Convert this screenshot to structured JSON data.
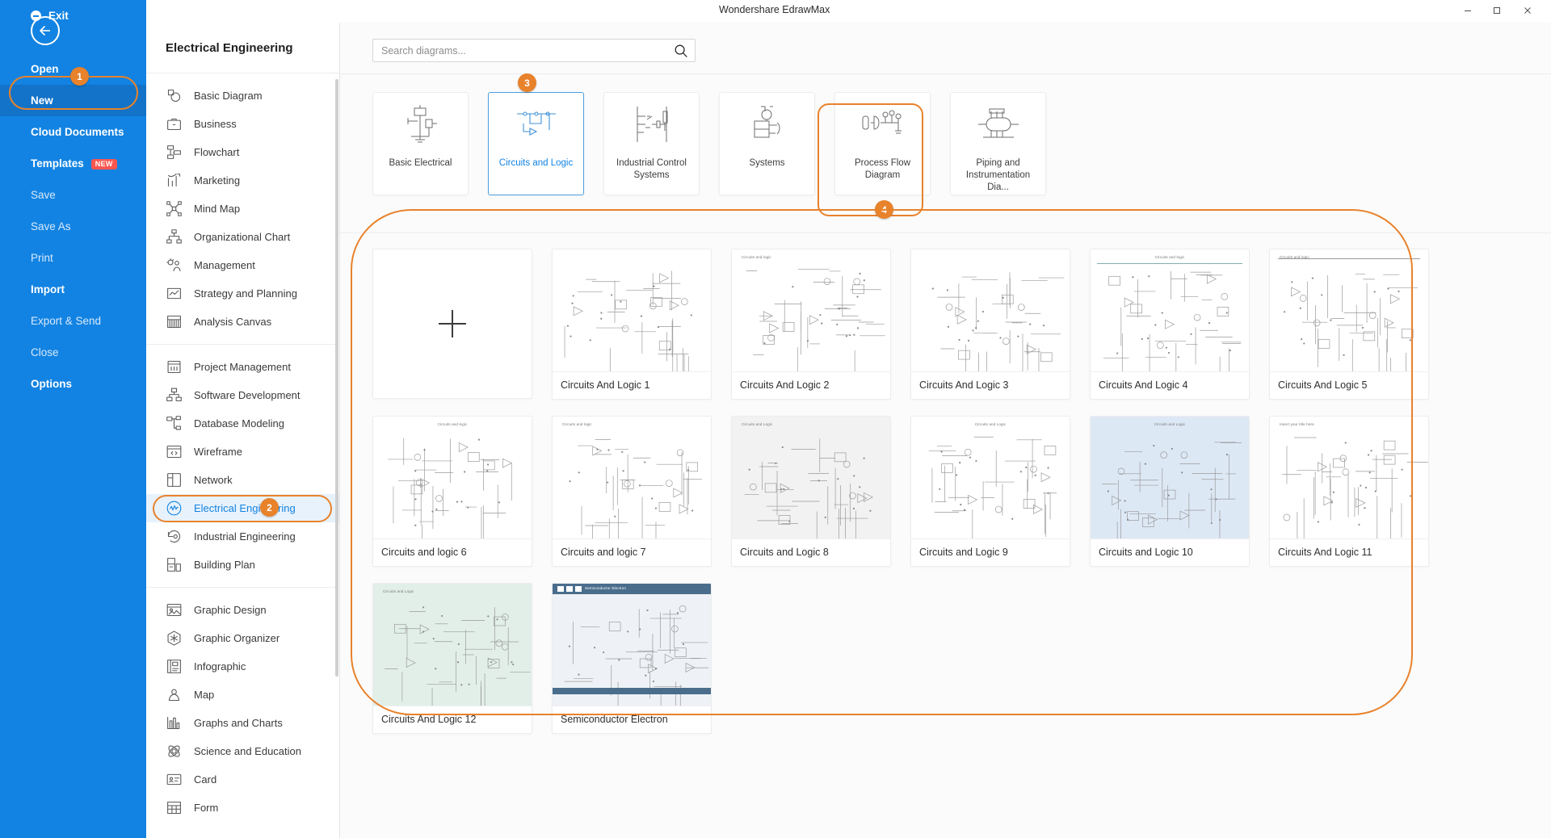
{
  "window": {
    "title": "Wondershare EdrawMax",
    "controls": {
      "minimize": "minimize-icon",
      "maximize": "maximize-icon",
      "close": "close-icon"
    }
  },
  "accent": {
    "orange": "#E8822B",
    "blue": "#1283e2",
    "selected_bg": "#e8f2fc"
  },
  "left_menu": {
    "back_icon": "back-arrow-icon",
    "items": [
      {
        "label": "Open",
        "state": "normal"
      },
      {
        "label": "New",
        "state": "active"
      },
      {
        "label": "Cloud Documents",
        "state": "normal"
      },
      {
        "label": "Templates",
        "state": "normal",
        "badge": "NEW"
      },
      {
        "label": "Save",
        "state": "dim"
      },
      {
        "label": "Save As",
        "state": "dim"
      },
      {
        "label": "Print",
        "state": "dim"
      },
      {
        "label": "Import",
        "state": "normal"
      },
      {
        "label": "Export & Send",
        "state": "dim"
      },
      {
        "label": "Close",
        "state": "dim"
      },
      {
        "label": "Options",
        "state": "normal"
      }
    ],
    "exit": {
      "label": "Exit",
      "icon": "exit-icon"
    }
  },
  "category_panel": {
    "header": "Electrical Engineering",
    "groups": [
      {
        "items": [
          {
            "label": "Basic Diagram",
            "icon": "basic-diagram-icon"
          },
          {
            "label": "Business",
            "icon": "briefcase-icon"
          },
          {
            "label": "Flowchart",
            "icon": "flowchart-icon"
          },
          {
            "label": "Marketing",
            "icon": "bar-chart-icon"
          },
          {
            "label": "Mind Map",
            "icon": "mind-map-icon"
          },
          {
            "label": "Organizational Chart",
            "icon": "org-chart-icon"
          },
          {
            "label": "Management",
            "icon": "management-icon"
          },
          {
            "label": "Strategy and Planning",
            "icon": "strategy-icon"
          },
          {
            "label": "Analysis Canvas",
            "icon": "analysis-canvas-icon"
          }
        ]
      },
      {
        "items": [
          {
            "label": "Project Management",
            "icon": "project-management-icon"
          },
          {
            "label": "Software Development",
            "icon": "software-dev-icon"
          },
          {
            "label": "Database Modeling",
            "icon": "database-modeling-icon"
          },
          {
            "label": "Wireframe",
            "icon": "wireframe-icon"
          },
          {
            "label": "Network",
            "icon": "network-icon"
          },
          {
            "label": "Electrical Engineering",
            "icon": "electrical-engineering-icon",
            "selected": true
          },
          {
            "label": "Industrial Engineering",
            "icon": "industrial-engineering-icon"
          },
          {
            "label": "Building Plan",
            "icon": "building-plan-icon"
          }
        ]
      },
      {
        "items": [
          {
            "label": "Graphic Design",
            "icon": "graphic-design-icon"
          },
          {
            "label": "Graphic Organizer",
            "icon": "graphic-organizer-icon"
          },
          {
            "label": "Infographic",
            "icon": "infographic-icon"
          },
          {
            "label": "Map",
            "icon": "map-icon"
          },
          {
            "label": "Graphs and Charts",
            "icon": "graphs-charts-icon"
          },
          {
            "label": "Science and Education",
            "icon": "science-education-icon"
          },
          {
            "label": "Card",
            "icon": "card-icon"
          },
          {
            "label": "Form",
            "icon": "form-icon"
          }
        ]
      }
    ]
  },
  "search": {
    "value": "",
    "placeholder": "Search diagrams...",
    "icon": "search-icon"
  },
  "subcategories": [
    {
      "label": "Basic Electrical",
      "icon": "basic-electrical-icon",
      "active": false
    },
    {
      "label": "Circuits and Logic",
      "icon": "circuits-logic-icon",
      "active": true
    },
    {
      "label": "Industrial Control\nSystems",
      "icon": "industrial-control-icon",
      "active": false
    },
    {
      "label": "Systems",
      "icon": "systems-icon",
      "active": false
    },
    {
      "label": "Process Flow Diagram",
      "icon": "process-flow-icon",
      "active": false
    },
    {
      "label": "Piping and\nInstrumentation Dia...",
      "icon": "piping-instr-icon",
      "active": false
    }
  ],
  "templates": {
    "new_blank": {
      "label": "",
      "icon": "plus-icon"
    },
    "rows": [
      [
        {
          "name": "Circuits And Logic 1",
          "preview_title": "",
          "style": "plain"
        },
        {
          "name": "Circuits And Logic 2",
          "preview_title": "Circuits and logic",
          "style": "plain"
        },
        {
          "name": "Circuits And Logic 3",
          "preview_title": "",
          "style": "plain"
        },
        {
          "name": "Circuits And Logic 4",
          "preview_title": "Circuits and logic",
          "style": "lined"
        },
        {
          "name": "Circuits And Logic 5",
          "preview_title": "Circuits and logic",
          "style": "ruled"
        }
      ],
      [
        {
          "name": "Circuits and logic 6",
          "preview_title": "Circuits and logic",
          "style": "plain"
        },
        {
          "name": "Circuits and logic 7",
          "preview_title": "Circuits and logic",
          "style": "plain"
        },
        {
          "name": "Circuits and Logic 8",
          "preview_title": "Circuits and Logic",
          "style": "grey"
        },
        {
          "name": "Circuits and Logic 9",
          "preview_title": "Circuits and Logic",
          "style": "plain"
        },
        {
          "name": "Circuits and Logic 10",
          "preview_title": "Circuits and Logic",
          "style": "bluefill"
        },
        {
          "name": "Circuits And Logic 11",
          "preview_title": "Insert your title here",
          "style": "plain"
        }
      ],
      [
        {
          "name": "Circuits And Logic 12",
          "preview_title": "Circuits and Logic",
          "style": "mintfill"
        },
        {
          "name": "Semiconductor Electron",
          "preview_title": "Semiconductor Electron",
          "style": "banner"
        }
      ]
    ]
  },
  "annotations": [
    {
      "number": "1",
      "target": "new-menu-item"
    },
    {
      "number": "2",
      "target": "sidebar-item-electrical-engineering"
    },
    {
      "number": "3",
      "target": "subcategory-circuits-and-logic"
    },
    {
      "number": "4",
      "target": "templates-grid"
    }
  ]
}
